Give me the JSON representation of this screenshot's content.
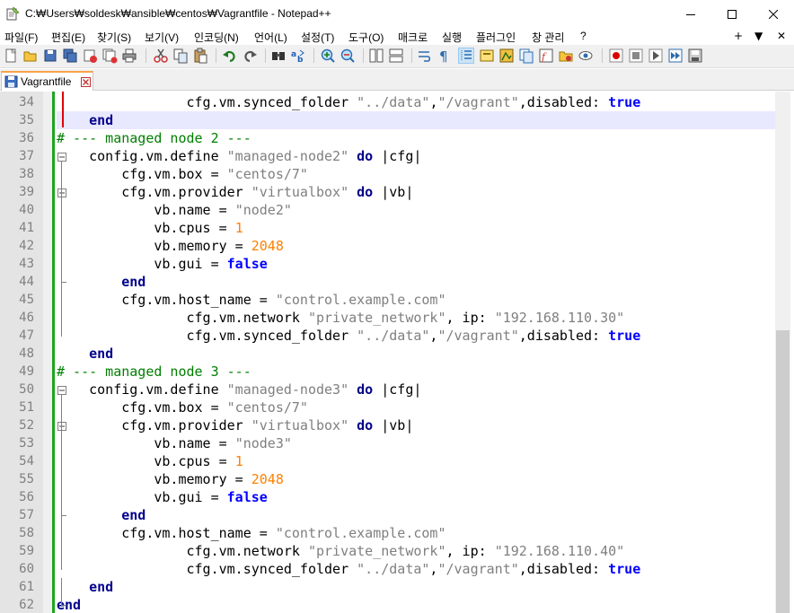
{
  "window": {
    "title": "C:₩Users₩soldesk₩ansible₩centos₩Vagrantfile - Notepad++",
    "minimize_icon": "minimize-icon",
    "maximize_icon": "maximize-icon",
    "close_icon": "close-icon"
  },
  "menu": {
    "items": [
      "파일(F)",
      "편집(E)",
      "찾기(S)",
      "보기(V)",
      "인코딩(N)",
      "언어(L)",
      "설정(T)",
      "도구(O)",
      "매크로",
      "실행",
      "플러그인",
      "창 관리",
      "?"
    ],
    "right": [
      "+",
      "▼",
      "✕"
    ]
  },
  "tab": {
    "label": "Vagrantfile",
    "icon": "save-disk-icon",
    "close_icon": "tab-close-icon"
  },
  "editor": {
    "lines": [
      {
        "n": "34",
        "segs": [
          [
            "p",
            "                "
          ],
          [
            "p",
            "cfg.vm.synced_folder "
          ],
          [
            "s",
            "\"../data\""
          ],
          [
            "p",
            ","
          ],
          [
            "s",
            "\"/vagrant\""
          ],
          [
            "p",
            ",disabled: "
          ],
          [
            "b",
            "true"
          ]
        ]
      },
      {
        "n": "35",
        "segs": [
          [
            "p",
            "    "
          ],
          [
            "k",
            "end"
          ]
        ]
      },
      {
        "n": "36",
        "segs": [
          [
            "c",
            "# --- managed node 2 ---"
          ]
        ]
      },
      {
        "n": "37",
        "segs": [
          [
            "p",
            "    config.vm.define "
          ],
          [
            "s",
            "\"managed-node2\""
          ],
          [
            "p",
            " "
          ],
          [
            "k",
            "do"
          ],
          [
            "p",
            " |cfg|"
          ]
        ]
      },
      {
        "n": "38",
        "segs": [
          [
            "p",
            "        cfg.vm.box = "
          ],
          [
            "s",
            "\"centos/7\""
          ]
        ]
      },
      {
        "n": "39",
        "segs": [
          [
            "p",
            "        cfg.vm.provider "
          ],
          [
            "s",
            "\"virtualbox\""
          ],
          [
            "p",
            " "
          ],
          [
            "k",
            "do"
          ],
          [
            "p",
            " |vb|"
          ]
        ]
      },
      {
        "n": "40",
        "segs": [
          [
            "p",
            "            vb.name = "
          ],
          [
            "s",
            "\"node2\""
          ]
        ]
      },
      {
        "n": "41",
        "segs": [
          [
            "p",
            "            vb.cpus = "
          ],
          [
            "n",
            "1"
          ]
        ]
      },
      {
        "n": "42",
        "segs": [
          [
            "p",
            "            vb.memory = "
          ],
          [
            "n",
            "2048"
          ]
        ]
      },
      {
        "n": "43",
        "segs": [
          [
            "p",
            "            vb.gui = "
          ],
          [
            "b",
            "false"
          ]
        ]
      },
      {
        "n": "44",
        "segs": [
          [
            "p",
            "        "
          ],
          [
            "k",
            "end"
          ]
        ]
      },
      {
        "n": "45",
        "segs": [
          [
            "p",
            "        cfg.vm.host_name = "
          ],
          [
            "s",
            "\"control.example.com\""
          ]
        ]
      },
      {
        "n": "46",
        "segs": [
          [
            "p",
            "                cfg.vm.network "
          ],
          [
            "s",
            "\"private_network\""
          ],
          [
            "p",
            ", ip: "
          ],
          [
            "s",
            "\"192.168.110.30\""
          ]
        ]
      },
      {
        "n": "47",
        "segs": [
          [
            "p",
            "                cfg.vm.synced_folder "
          ],
          [
            "s",
            "\"../data\""
          ],
          [
            "p",
            ","
          ],
          [
            "s",
            "\"/vagrant\""
          ],
          [
            "p",
            ",disabled: "
          ],
          [
            "b",
            "true"
          ]
        ]
      },
      {
        "n": "48",
        "segs": [
          [
            "p",
            "    "
          ],
          [
            "k",
            "end"
          ]
        ]
      },
      {
        "n": "49",
        "segs": [
          [
            "c",
            "# --- managed node 3 ---"
          ]
        ]
      },
      {
        "n": "50",
        "segs": [
          [
            "p",
            "    config.vm.define "
          ],
          [
            "s",
            "\"managed-node3\""
          ],
          [
            "p",
            " "
          ],
          [
            "k",
            "do"
          ],
          [
            "p",
            " |cfg|"
          ]
        ]
      },
      {
        "n": "51",
        "segs": [
          [
            "p",
            "        cfg.vm.box = "
          ],
          [
            "s",
            "\"centos/7\""
          ]
        ]
      },
      {
        "n": "52",
        "segs": [
          [
            "p",
            "        cfg.vm.provider "
          ],
          [
            "s",
            "\"virtualbox\""
          ],
          [
            "p",
            " "
          ],
          [
            "k",
            "do"
          ],
          [
            "p",
            " |vb|"
          ]
        ]
      },
      {
        "n": "53",
        "segs": [
          [
            "p",
            "            vb.name = "
          ],
          [
            "s",
            "\"node3\""
          ]
        ]
      },
      {
        "n": "54",
        "segs": [
          [
            "p",
            "            vb.cpus = "
          ],
          [
            "n",
            "1"
          ]
        ]
      },
      {
        "n": "55",
        "segs": [
          [
            "p",
            "            vb.memory = "
          ],
          [
            "n",
            "2048"
          ]
        ]
      },
      {
        "n": "56",
        "segs": [
          [
            "p",
            "            vb.gui = "
          ],
          [
            "b",
            "false"
          ]
        ]
      },
      {
        "n": "57",
        "segs": [
          [
            "p",
            "        "
          ],
          [
            "k",
            "end"
          ]
        ]
      },
      {
        "n": "58",
        "segs": [
          [
            "p",
            "        cfg.vm.host_name = "
          ],
          [
            "s",
            "\"control.example.com\""
          ]
        ]
      },
      {
        "n": "59",
        "segs": [
          [
            "p",
            "                cfg.vm.network "
          ],
          [
            "s",
            "\"private_network\""
          ],
          [
            "p",
            ", ip: "
          ],
          [
            "s",
            "\"192.168.110.40\""
          ]
        ]
      },
      {
        "n": "60",
        "segs": [
          [
            "p",
            "                cfg.vm.synced_folder "
          ],
          [
            "s",
            "\"../data\""
          ],
          [
            "p",
            ","
          ],
          [
            "s",
            "\"/vagrant\""
          ],
          [
            "p",
            ",disabled: "
          ],
          [
            "b",
            "true"
          ]
        ]
      },
      {
        "n": "61",
        "segs": [
          [
            "p",
            "    "
          ],
          [
            "k",
            "end"
          ]
        ]
      },
      {
        "n": "62",
        "segs": [
          [
            "k",
            "end"
          ]
        ]
      }
    ],
    "current_line": "35",
    "fold_open_lines": [
      "37",
      "39",
      "50",
      "52"
    ],
    "fold_end_lines": [
      "44",
      "57"
    ]
  },
  "colors": {
    "keyword": "#00008b",
    "boolean": "#0000ff",
    "string": "#7f7f7f",
    "number": "#ff8000",
    "comment": "#007f00",
    "change_bar": "#1fa51f",
    "tab_accent": "#f9a24a"
  }
}
